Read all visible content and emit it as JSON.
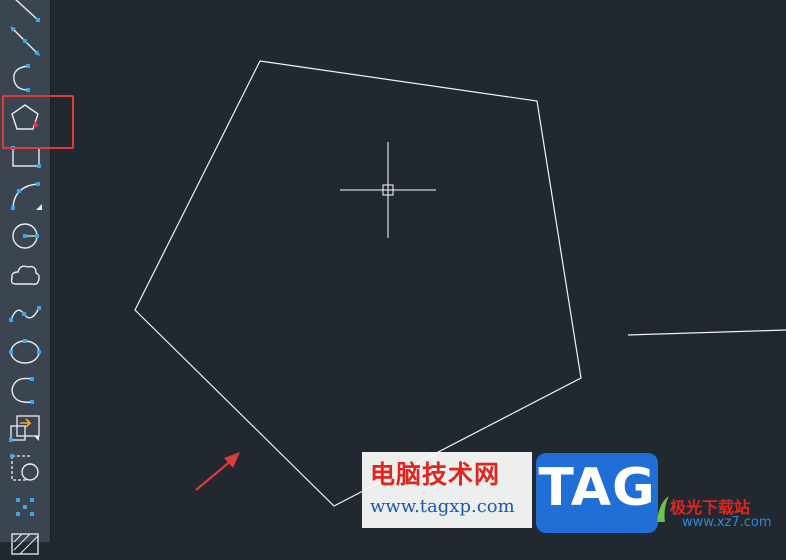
{
  "toolbar": {
    "items": [
      {
        "name": "line-tool",
        "icon": "line-icon"
      },
      {
        "name": "construction-line-tool",
        "icon": "xline-icon"
      },
      {
        "name": "polyline-tool",
        "icon": "polyline-icon"
      },
      {
        "name": "polygon-tool",
        "icon": "polygon-icon",
        "highlighted": true
      },
      {
        "name": "rectangle-tool",
        "icon": "rectangle-icon"
      },
      {
        "name": "arc-tool",
        "icon": "arc-icon"
      },
      {
        "name": "circle-tool",
        "icon": "circle-icon"
      },
      {
        "name": "revision-cloud-tool",
        "icon": "cloud-icon"
      },
      {
        "name": "spline-tool",
        "icon": "spline-icon"
      },
      {
        "name": "ellipse-tool",
        "icon": "ellipse-icon"
      },
      {
        "name": "elliptical-arc-tool",
        "icon": "ellipse-arc-icon"
      },
      {
        "name": "insert-block-tool",
        "icon": "insert-block-icon"
      },
      {
        "name": "create-block-tool",
        "icon": "create-block-icon"
      },
      {
        "name": "point-tool",
        "icon": "point-icon"
      },
      {
        "name": "hatch-tool",
        "icon": "hatch-icon"
      }
    ]
  },
  "canvas": {
    "background": "#212830",
    "drawn_shape": "pentagon",
    "line_color": "#ffffff",
    "cursor": "crosshair-cursor"
  },
  "annotation_color": "#e03a3a",
  "watermark": {
    "site_title": "电脑技术网",
    "site_url": "www.tagxp.com",
    "tag_logo_text": "TAG",
    "xz7_title": "极光下载站",
    "xz7_url": "www.xz7.com"
  }
}
